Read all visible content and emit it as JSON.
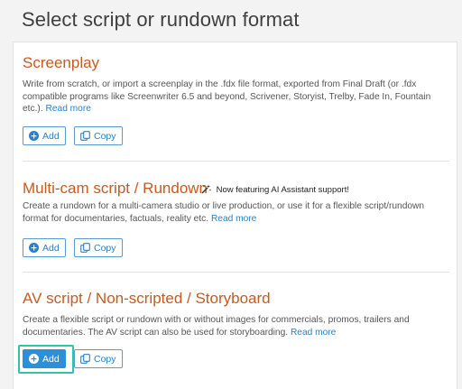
{
  "page": {
    "title": "Select script or rundown format"
  },
  "sections": [
    {
      "title": "Screenplay",
      "description": "Write from scratch, or import a screenplay in the .fdx file format, exported from Final Draft (or .fdx compatible programs like Screenwriter 6.5 and beyond, Scrivener, Storyist, Trelby, Fade In, Fountain etc.).",
      "read_more": "Read more",
      "add_label": "Add",
      "copy_label": "Copy"
    },
    {
      "title": "Multi-cam script / Rundown",
      "badge": "Now featuring AI Assistant support!",
      "description": "Create a rundown for a multi-camera studio or live production, or use it for a flexible script/rundown format for documentaries, factuals, reality etc.",
      "read_more": "Read more",
      "add_label": "Add",
      "copy_label": "Copy"
    },
    {
      "title": "AV script / Non-scripted / Storyboard",
      "description": "Create a flexible script or rundown with or without images for commercials, promos, trailers and documentaries. The AV script can also be used for storyboarding.",
      "read_more": "Read more",
      "add_label": "Add",
      "copy_label": "Copy"
    }
  ],
  "colors": {
    "title_accent": "#c75a1f",
    "link": "#2a80c6",
    "selected_button": "#2d8fd8",
    "focus_outline": "#2bc7a6"
  },
  "icons": [
    "plus-circle-icon",
    "copy-icon",
    "magic-wand-icon"
  ]
}
